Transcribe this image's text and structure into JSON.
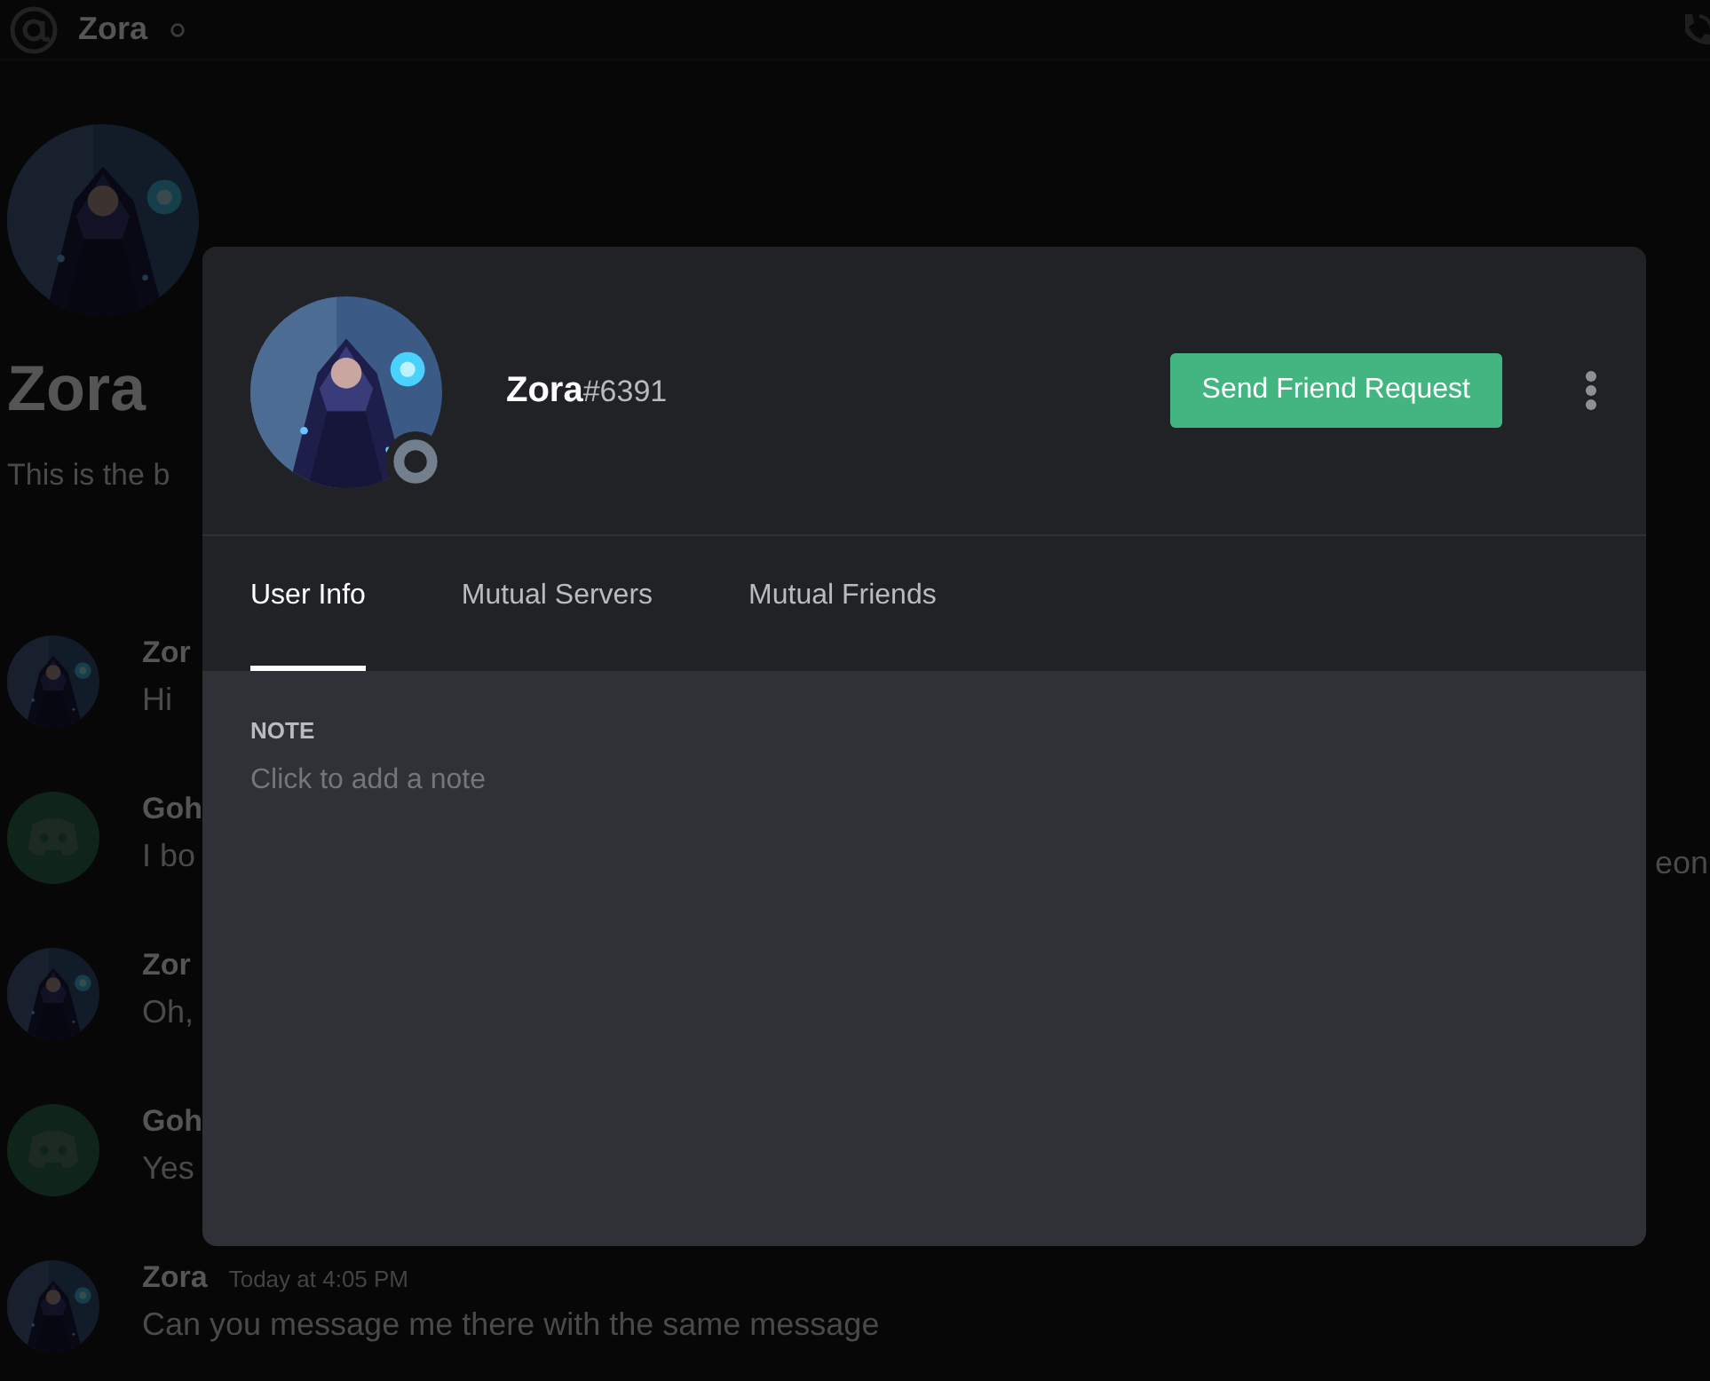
{
  "header": {
    "title": "Zora"
  },
  "intro": {
    "name": "Zora",
    "text": "This is the b"
  },
  "messages": [
    {
      "author": "Zor",
      "kind": "picture",
      "text": "Hi"
    },
    {
      "author": "Goh",
      "kind": "logo",
      "text": "I bo",
      "tail": "eon"
    },
    {
      "author": "Zor",
      "kind": "picture",
      "text": "Oh,"
    },
    {
      "author": "Goh",
      "kind": "logo",
      "text": "Yes"
    },
    {
      "author": "Zora",
      "kind": "picture",
      "timestamp": "Today at 4:05 PM",
      "text": "Can you message me there with the same message"
    }
  ],
  "profile": {
    "name": "Zora",
    "discriminator": "#6391",
    "action": "Send Friend Request",
    "tabs": [
      {
        "label": "User Info",
        "selected": true
      },
      {
        "label": "Mutual Servers",
        "selected": false
      },
      {
        "label": "Mutual Friends",
        "selected": false
      }
    ],
    "note": {
      "label": "NOTE",
      "placeholder": "Click to add a note"
    }
  }
}
